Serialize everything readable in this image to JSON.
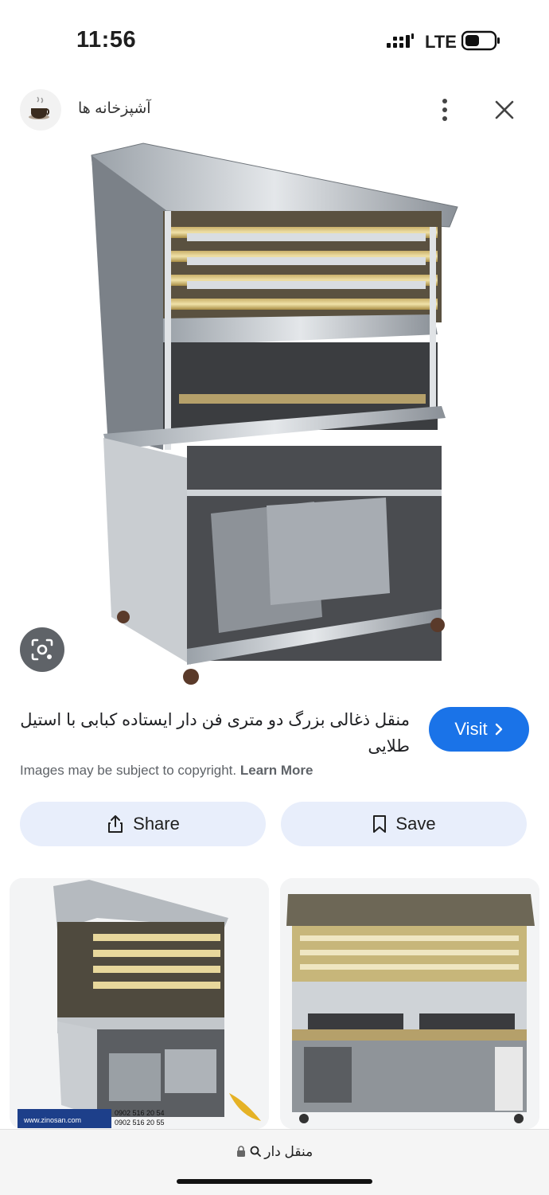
{
  "status": {
    "time": "11:56",
    "network": "LTE"
  },
  "source": {
    "name": "آشپزخانه ها"
  },
  "image": {
    "title": "منقل ذغالی بزرگ دو متری فن دار ایستاده کبابی با استیل طلایی"
  },
  "visit_label": "Visit",
  "copyright": {
    "text": "Images may be subject to copyright.",
    "learn_more": "Learn More"
  },
  "actions": {
    "share": "Share",
    "save": "Save"
  },
  "related": {
    "badge_site": "www.zinosan.com",
    "badge_phone1": "0902 516 20 54",
    "badge_phone2": "0902 516 20 55"
  },
  "address_bar": {
    "url": "منقل دار"
  },
  "colors": {
    "accent": "#1a73e8",
    "chip_bg": "#e8eefb"
  }
}
